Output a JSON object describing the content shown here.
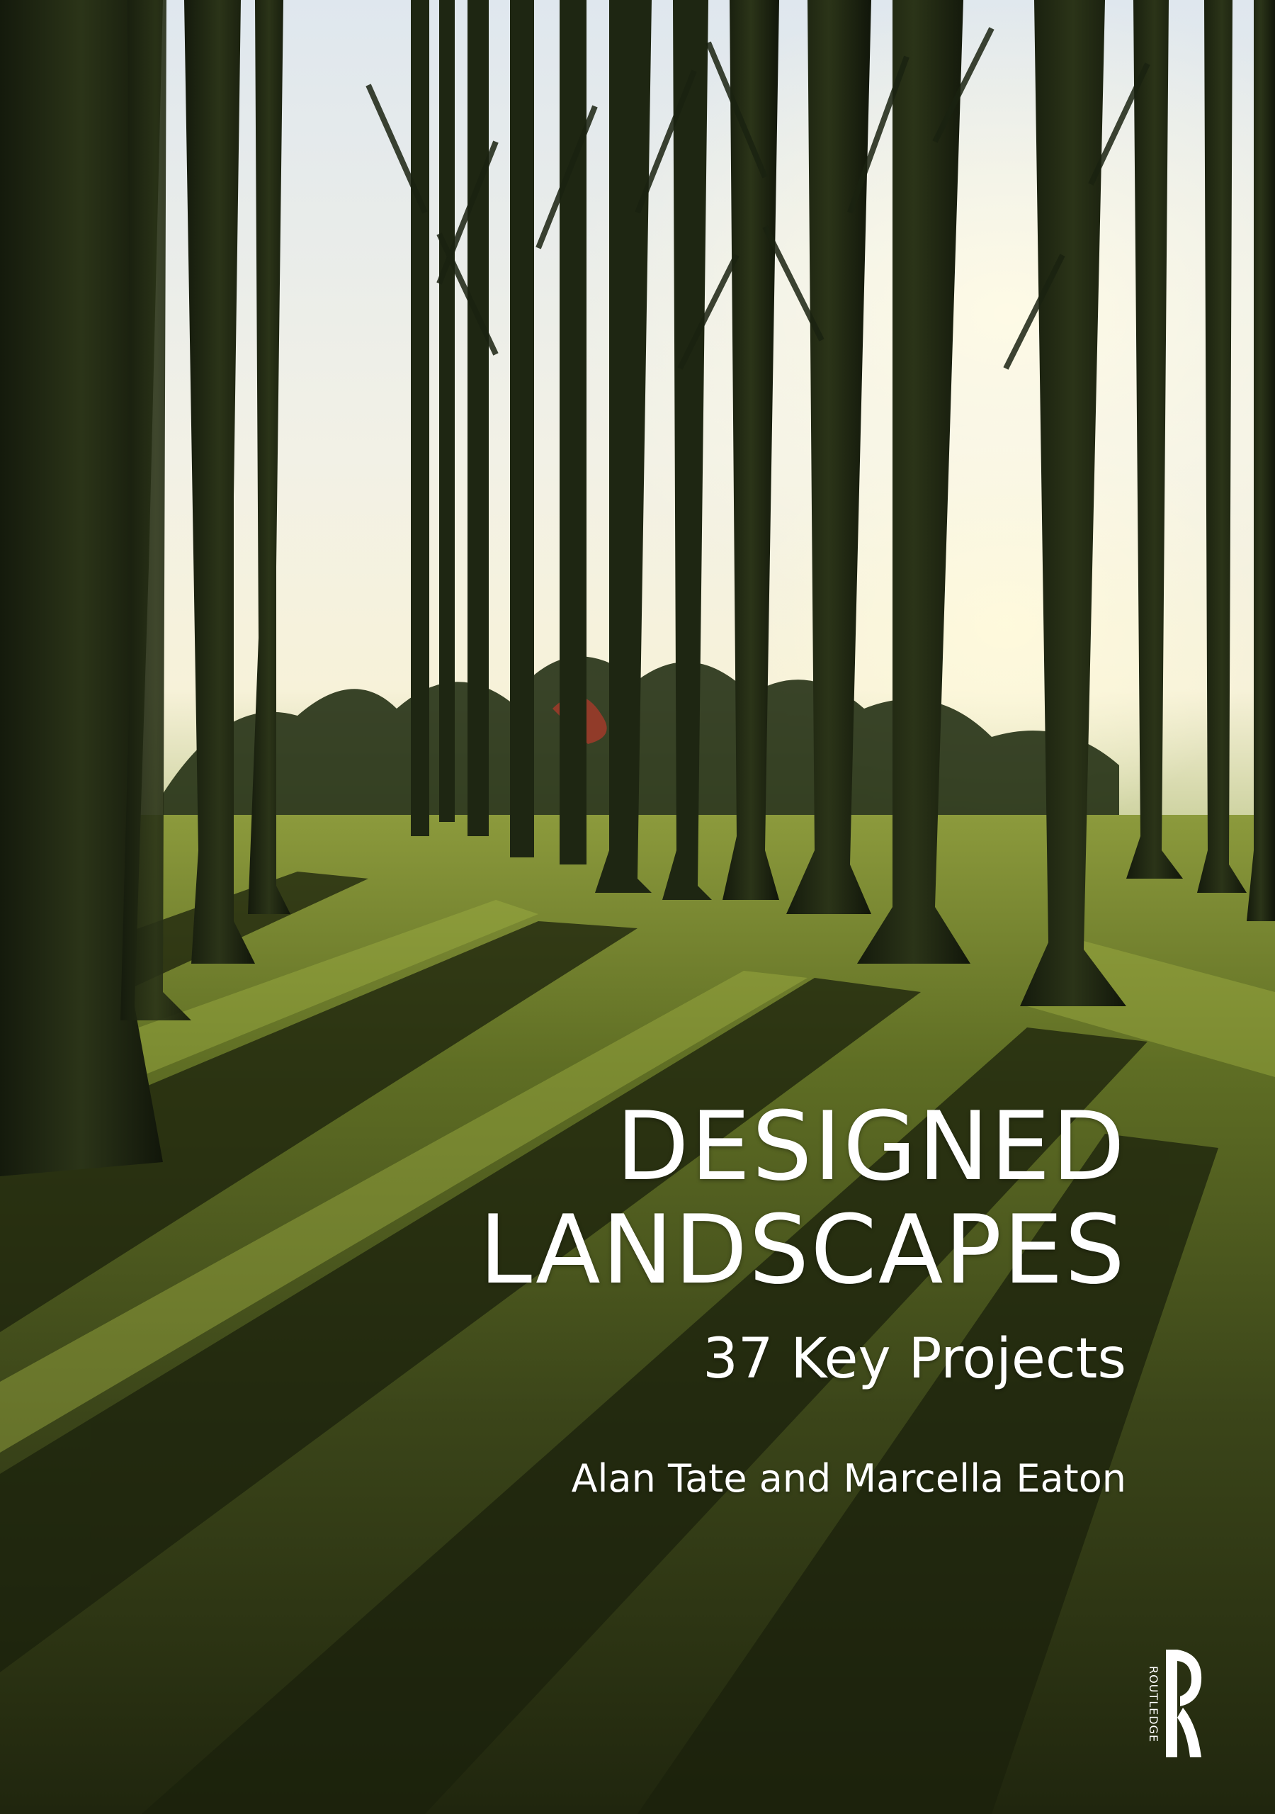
{
  "book": {
    "title_line1": "DESIGNED",
    "title_line2": "LANDSCAPES",
    "subtitle": "37 Key Projects",
    "authors": "Alan Tate and Marcella Eaton"
  },
  "publisher": {
    "name": "ROUTLEDGE",
    "logo_icon": "routledge-r-logo"
  },
  "photo": {
    "scene": "avenue-of-trees-with-shadows-icon"
  },
  "colors": {
    "text": "#ffffff",
    "sky": "#f4f2de",
    "grass": "#5e6e24",
    "shadow": "#1a2109"
  }
}
